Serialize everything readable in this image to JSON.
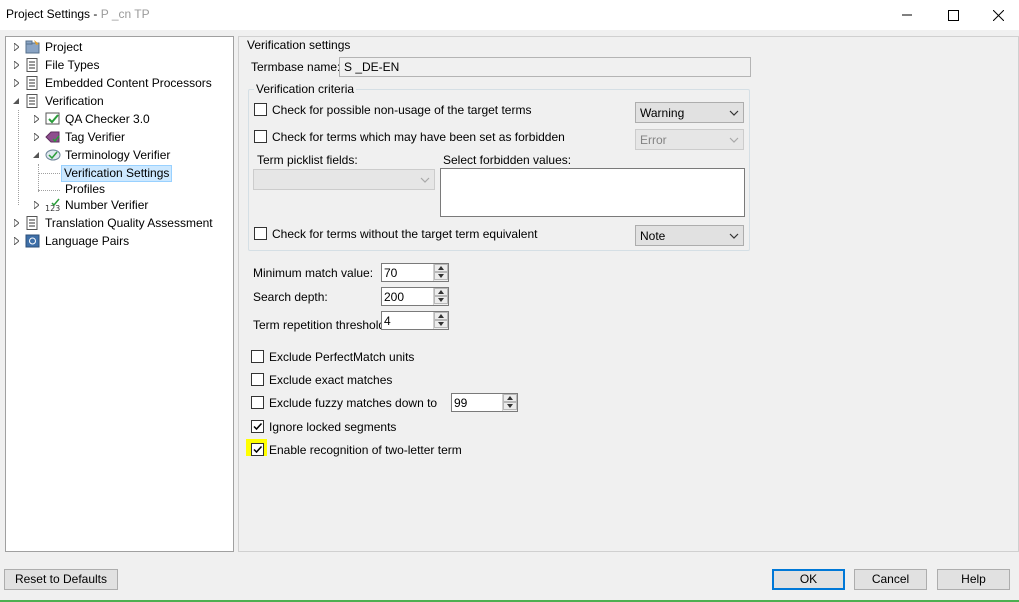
{
  "window": {
    "title": "Project Settings - ",
    "title_obscured": "P              _cn  TP"
  },
  "tree": {
    "items": [
      {
        "label": "Project",
        "icon": "project-icon"
      },
      {
        "label": "File Types",
        "icon": "file-types-icon"
      },
      {
        "label": "Embedded Content Processors",
        "icon": "embedded-content-icon"
      },
      {
        "label": "Verification",
        "icon": "verification-icon"
      },
      {
        "label": "QA Checker 3.0",
        "icon": "qa-checker-icon"
      },
      {
        "label": "Tag Verifier",
        "icon": "tag-verifier-icon"
      },
      {
        "label": "Terminology Verifier",
        "icon": "terminology-verifier-icon"
      },
      {
        "label": "Verification Settings",
        "icon": ""
      },
      {
        "label": "Profiles",
        "icon": ""
      },
      {
        "label": "Number Verifier",
        "icon": "number-verifier-icon"
      },
      {
        "label": "Translation Quality Assessment",
        "icon": "tqa-icon"
      },
      {
        "label": "Language Pairs",
        "icon": "language-pairs-icon"
      }
    ]
  },
  "settings": {
    "heading": "Verification settings",
    "termbase_label": "Termbase name:",
    "termbase_value": "S          _DE-EN",
    "criteria_legend": "Verification criteria",
    "check_nonusage": {
      "label": "Check for possible non-usage of the target terms",
      "checked": false,
      "severity": "Warning"
    },
    "check_forbidden": {
      "label": "Check for terms which may have been set as forbidden",
      "checked": false,
      "severity": "Error"
    },
    "picklist_label": "Term picklist fields:",
    "forbidden_values_label": "Select forbidden values:",
    "check_no_equivalent": {
      "label": "Check for terms without the target term equivalent",
      "checked": false,
      "severity": "Note"
    },
    "min_match_label": "Minimum match value:",
    "min_match_value": "70",
    "search_depth_label": "Search depth:",
    "search_depth_value": "200",
    "repetition_label": "Term repetition threshold:",
    "repetition_value": "4",
    "exclude_perfect": {
      "label": "Exclude PerfectMatch units",
      "checked": false
    },
    "exclude_exact": {
      "label": "Exclude exact matches",
      "checked": false
    },
    "exclude_fuzzy": {
      "label": "Exclude fuzzy matches down to",
      "checked": false,
      "value": "99"
    },
    "ignore_locked": {
      "label": "Ignore locked segments",
      "checked": true
    },
    "two_letter": {
      "label": "Enable recognition of two-letter term",
      "checked": true,
      "highlight": "#ffff00"
    }
  },
  "buttons": {
    "reset": "Reset to Defaults",
    "ok": "OK",
    "cancel": "Cancel",
    "help": "Help"
  },
  "colors": {
    "accent": "#0078d7",
    "selection": "#cce8ff",
    "highlight": "#ffff00"
  }
}
